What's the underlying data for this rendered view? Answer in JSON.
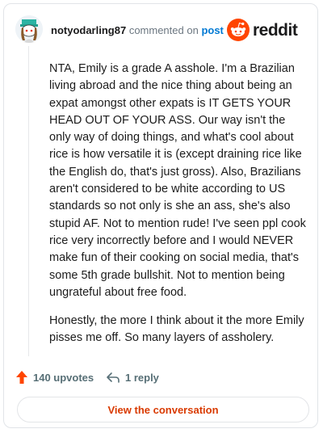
{
  "header": {
    "username": "notyodarling87",
    "action_text": "commented on",
    "post_link": "post",
    "brand": "reddit",
    "avatar_icon": "snoo-avatar-icon",
    "brand_icon": "reddit-logo-icon"
  },
  "comment": {
    "paragraphs": [
      "NTA, Emily is a grade A asshole. I'm a Brazilian living abroad and the nice thing about being an expat amongst other expats is IT GETS YOUR HEAD OUT OF YOUR ASS. Our way isn't the only way of doing things, and what's cool about rice is how versatile it is (except draining rice like the English do, that's just gross). Also, Brazilians aren't considered to be white according to US standards so not only is she an ass, she's also stupid AF. Not to mention rude! I've seen ppl cook rice very incorrectly before and I would NEVER make fun of their cooking on social media, that's some 5th grade bullshit. Not to mention being ungrateful about free food.",
      "Honestly, the more I think about it the more Emily pisses me off. So many layers of assholery."
    ]
  },
  "actions": {
    "upvotes": "140 upvotes",
    "replies": "1 reply",
    "upvote_icon": "upvote-arrow-icon",
    "reply_icon": "reply-arrow-icon"
  },
  "footer": {
    "button_label": "View the conversation"
  },
  "colors": {
    "accent": "#d93a00",
    "brand_orange": "#ff4500",
    "link": "#0079d3",
    "border": "#e1e4e8"
  }
}
